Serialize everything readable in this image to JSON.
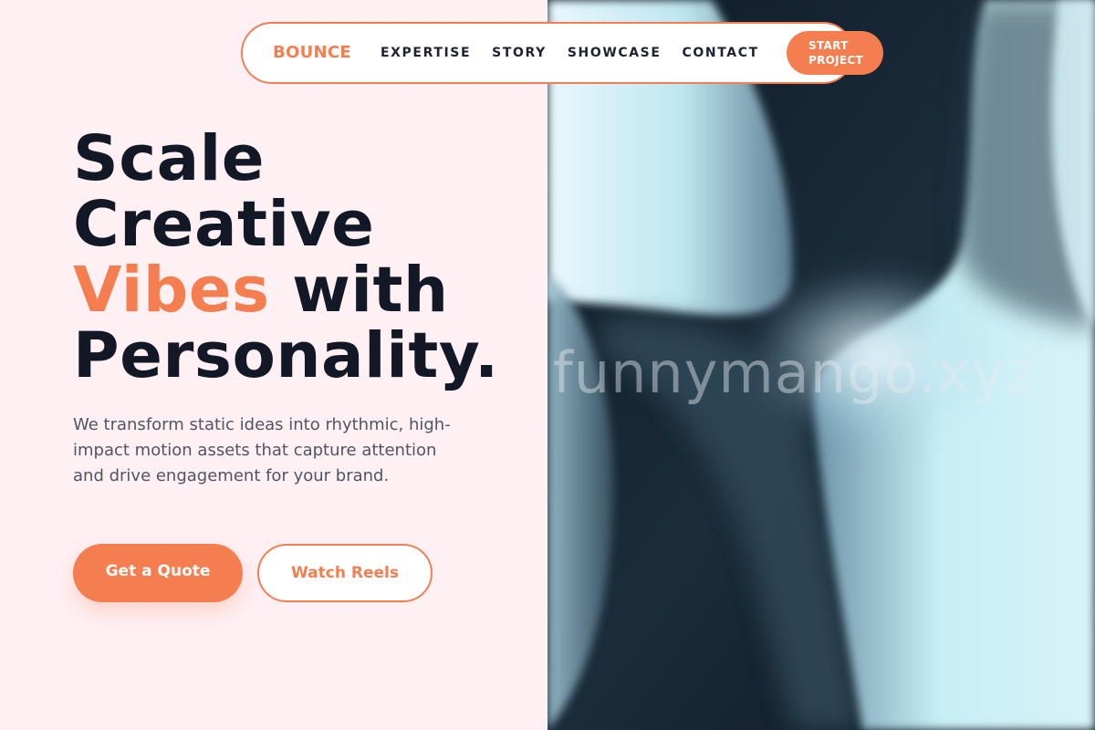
{
  "nav": {
    "brand": "BOUNCE",
    "links": [
      "EXPERTISE",
      "STORY",
      "SHOWCASE",
      "CONTACT"
    ],
    "cta_line1": "START",
    "cta_line2": "PROJECT"
  },
  "hero": {
    "title_line1": "Scale",
    "title_line2": "Creative",
    "title_accent": "Vibes",
    "title_line3_rest": " with",
    "title_line4": "Personality.",
    "description": "We transform static ideas into rhythmic, high-impact motion assets that capture attention and drive engagement for your brand.",
    "primary_button": "Get a Quote",
    "secondary_button": "Watch Reels"
  },
  "image": {
    "watermark_text": "funnymango.xyz"
  },
  "colors": {
    "accent": "#f47e50",
    "heading": "#121826",
    "body_text": "#4f5563",
    "left_background": "#fff0f4"
  }
}
